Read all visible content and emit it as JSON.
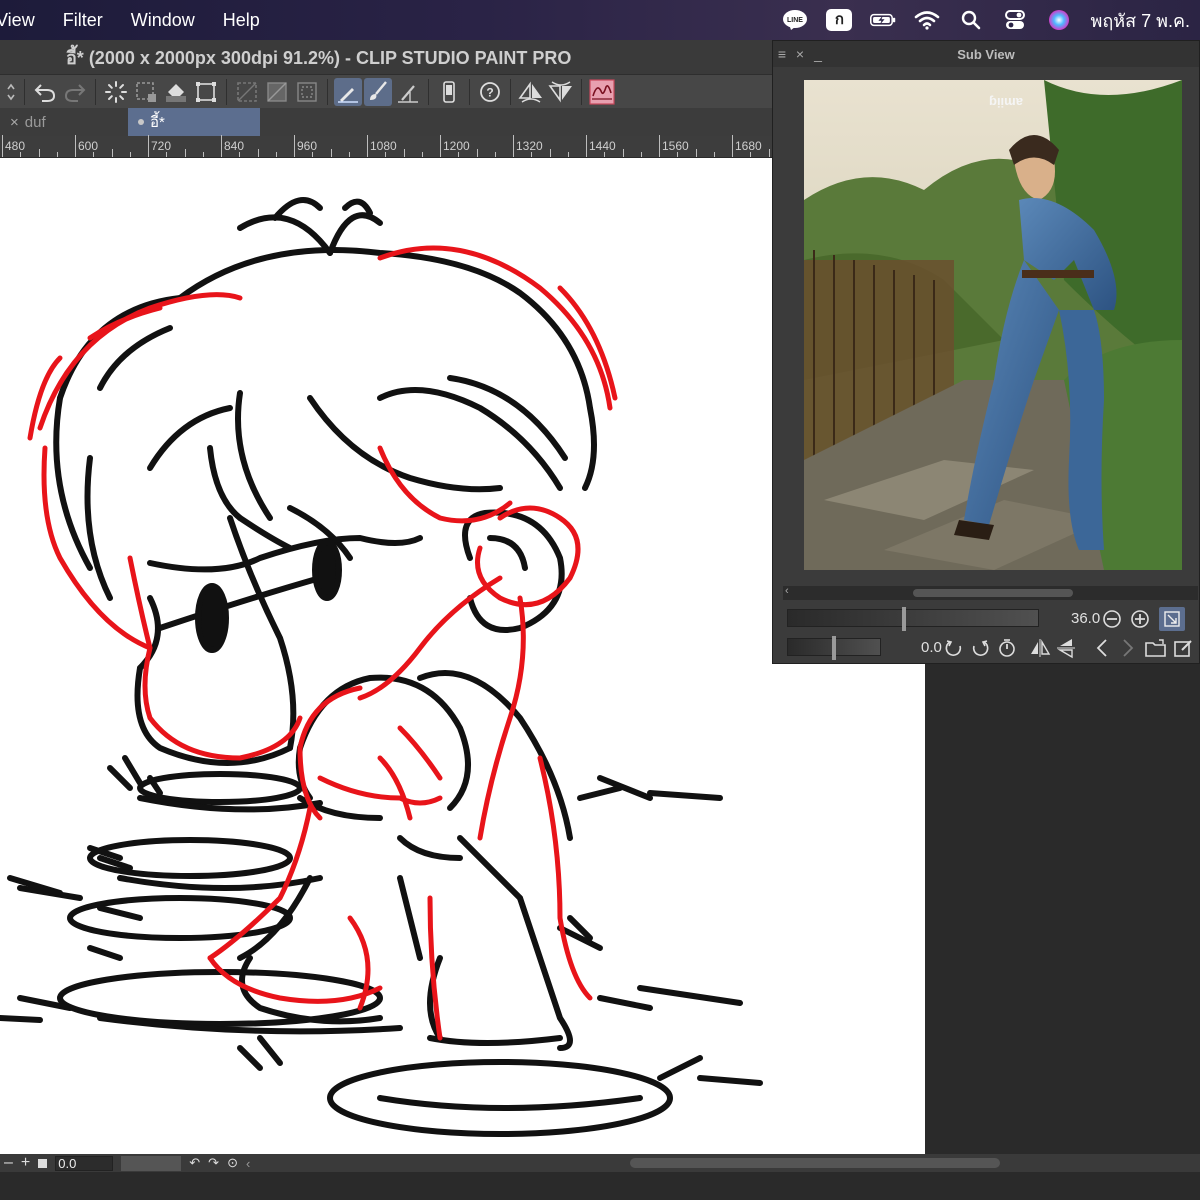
{
  "menubar": {
    "items": [
      "View",
      "Filter",
      "Window",
      "Help"
    ],
    "input_source": "ก",
    "clock": "พฤหัส 7 พ.ค."
  },
  "window": {
    "title": "อี้* (2000 x 2000px 300dpi 91.2%)  - CLIP STUDIO PAINT PRO"
  },
  "tabs": [
    {
      "label": "duf",
      "active": false
    },
    {
      "label": "อี้*",
      "active": true
    }
  ],
  "ruler": {
    "labels": [
      "480",
      "600",
      "720",
      "840",
      "960",
      "1080",
      "1200",
      "1320",
      "1440",
      "1560",
      "1680"
    ]
  },
  "subview": {
    "title": "Sub View",
    "zoom_value": "36.0",
    "rotate_value": "0.0"
  },
  "status": {
    "zoom_value": "0.0"
  },
  "colors": {
    "sketch_black": "#111111",
    "sketch_red": "#e8141a",
    "active_tab": "#5c6e8f",
    "canvas": "#ffffff"
  }
}
